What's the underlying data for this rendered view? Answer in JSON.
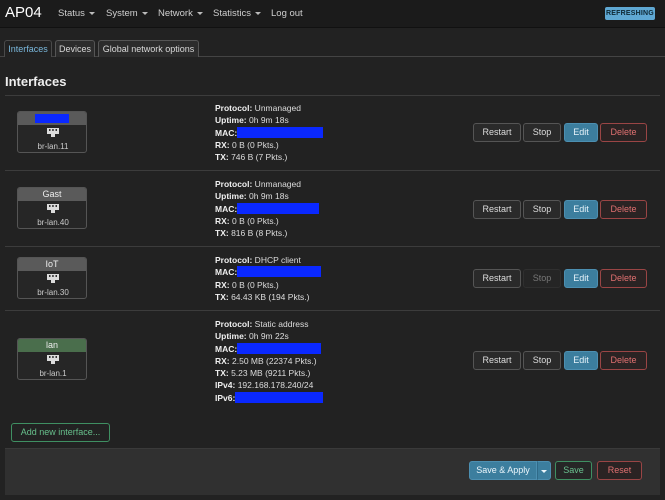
{
  "header": {
    "brand": "AP04",
    "menu": [
      "Status",
      "System",
      "Network",
      "Statistics",
      "Log out"
    ],
    "refreshing": "REFRESHING"
  },
  "tabs": [
    "Interfaces",
    "Devices",
    "Global network options"
  ],
  "section_title": "Interfaces",
  "labels": {
    "protocol": "Protocol:",
    "uptime": "Uptime:",
    "mac": "MAC:",
    "rx": "RX:",
    "tx": "TX:",
    "ipv4": "IPv4:",
    "ipv6": "IPv6:"
  },
  "interfaces": [
    {
      "name": "",
      "device": "br-lan.11",
      "protocol": " Unmanaged",
      "uptime": " 0h 9m 18s",
      "rx": " 0 B (0 Pkts.)",
      "tx": " 746 B (7 Pkts.)"
    },
    {
      "name": "Gast",
      "device": "br-lan.40",
      "protocol": " Unmanaged",
      "uptime": " 0h 9m 18s",
      "rx": " 0 B (0 Pkts.)",
      "tx": " 816 B (8 Pkts.)"
    },
    {
      "name": "IoT",
      "device": "br-lan.30",
      "protocol": " DHCP client",
      "rx": " 0 B (0 Pkts.)",
      "tx": " 64.43 KB (194 Pkts.)"
    },
    {
      "name": "lan",
      "device": "br-lan.1",
      "protocol": " Static address",
      "uptime": " 0h 9m 22s",
      "rx": " 2.50 MB (22374 Pkts.)",
      "tx": " 5.23 MB (9211 Pkts.)",
      "ipv4": " 192.168.178.240/24"
    }
  ],
  "buttons": {
    "restart": "Restart",
    "stop": "Stop",
    "edit": "Edit",
    "delete": "Delete",
    "add_interface": "Add new interface...",
    "save_apply": "Save & Apply",
    "save": "Save",
    "reset": "Reset"
  },
  "colors": {
    "accent": "#3c7e9e",
    "redaction": "#0a28ff",
    "lan_badge": "#4a6e4c"
  }
}
